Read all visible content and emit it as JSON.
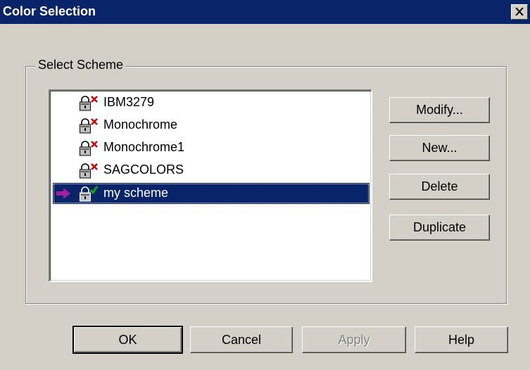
{
  "window": {
    "title": "Color Selection",
    "close_glyph": "X"
  },
  "group": {
    "legend": "Select Scheme"
  },
  "schemes": [
    {
      "label": "IBM3279",
      "status": "locked-invalid"
    },
    {
      "label": "Monochrome",
      "status": "locked-invalid"
    },
    {
      "label": "Monochrome1",
      "status": "locked-invalid"
    },
    {
      "label": "SAGCOLORS",
      "status": "locked-invalid"
    },
    {
      "label": "my scheme",
      "status": "locked-valid",
      "selected": true,
      "current": true
    }
  ],
  "side_buttons": {
    "modify": "Modify...",
    "new": "New...",
    "delete": "Delete",
    "duplicate": "Duplicate"
  },
  "bottom_buttons": {
    "ok": "OK",
    "cancel": "Cancel",
    "apply": "Apply",
    "help": "Help"
  },
  "colors": {
    "titlebar": "#0a246a",
    "selection": "#0a246a",
    "dialog": "#d4d0c8",
    "current_arrow": "#a020a0",
    "invalid_mark": "#d00000",
    "valid_mark": "#00a000"
  }
}
